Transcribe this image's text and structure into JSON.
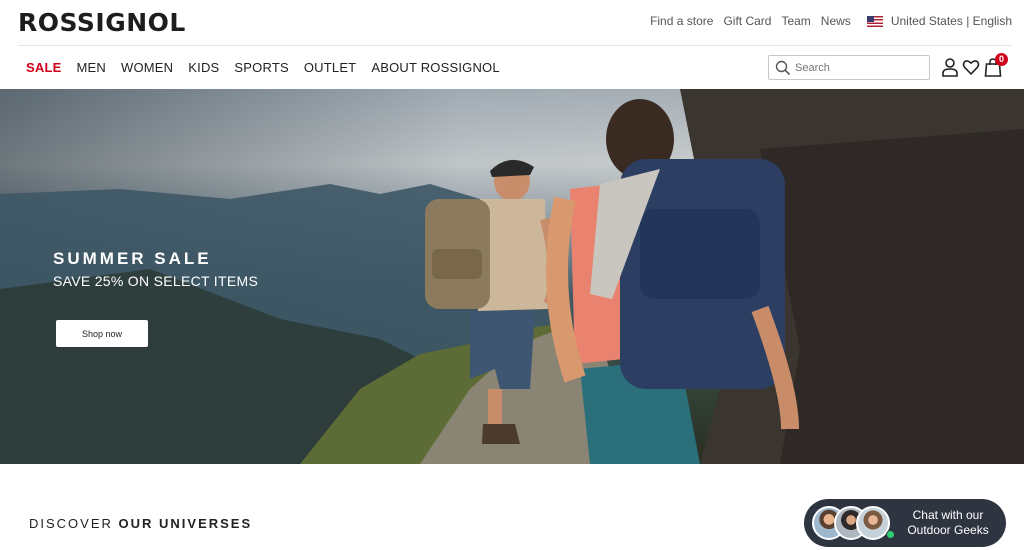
{
  "brand": {
    "logo": "ROSSIGNOL"
  },
  "utility_nav": {
    "links": [
      "Find a store",
      "Gift Card",
      "Team",
      "News"
    ],
    "locale": "United States | English",
    "flag_icon": "us-flag-icon"
  },
  "main_nav": {
    "items": [
      "SALE",
      "MEN",
      "WOMEN",
      "KIDS",
      "SPORTS",
      "OUTLET",
      "ABOUT ROSSIGNOL"
    ],
    "sale_color": "#d0021b"
  },
  "search": {
    "placeholder": "Search",
    "icon": "search-icon"
  },
  "header_icons": {
    "account": "user-icon",
    "wishlist": "heart-icon",
    "bag": "shopping-bag-icon",
    "bag_count": "0"
  },
  "hero": {
    "title": "SUMMER SALE",
    "subtitle": "SAVE 25% ON SELECT ITEMS",
    "cta_label": "Shop now"
  },
  "discover": {
    "prefix": "DISCOVER ",
    "emphasis": "OUR UNIVERSES"
  },
  "chat_widget": {
    "text": "Chat with our Outdoor Geeks",
    "background": "#2f3441",
    "status_color": "#2ecc71"
  }
}
